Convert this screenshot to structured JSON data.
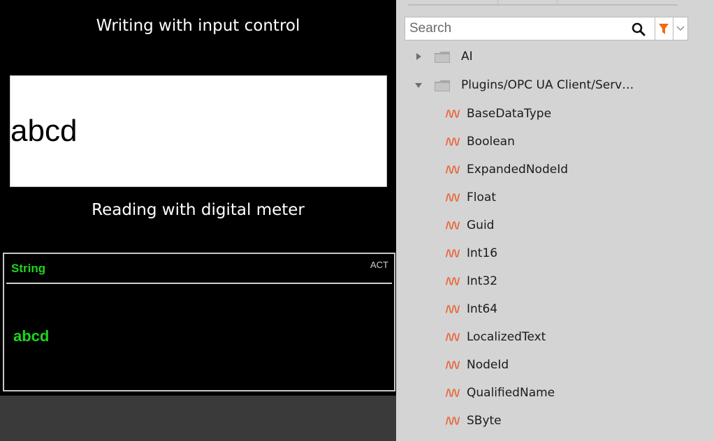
{
  "dashboard": {
    "write_caption": "Writing with input control",
    "input_value": "abcd",
    "read_caption": "Reading with digital meter",
    "meter": {
      "label": "String",
      "status": "ACT",
      "value": "abcd",
      "value_color": "#1ed41e"
    }
  },
  "tree_panel": {
    "search_placeholder": "Search",
    "filter_color": "#f26a12",
    "icons": {
      "search": "search-icon",
      "filter": "filter-icon",
      "dropdown": "chevron-down-icon",
      "folder": "folder-icon",
      "tag": "signal-wave-icon"
    },
    "folders": [
      {
        "label": "AI",
        "expanded": false
      },
      {
        "label": "Plugins/OPC UA Client/Serv…",
        "expanded": true
      }
    ],
    "tags": [
      "BaseDataType",
      "Boolean",
      "ExpandedNodeId",
      "Float",
      "Guid",
      "Int16",
      "Int32",
      "Int64",
      "LocalizedText",
      "NodeId",
      "QualifiedName",
      "SByte"
    ]
  }
}
